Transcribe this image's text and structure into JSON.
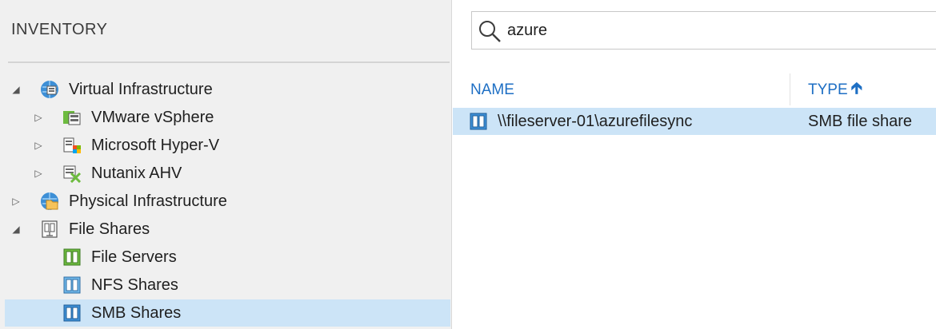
{
  "inventory": {
    "title": "INVENTORY",
    "tree": [
      {
        "label": "Virtual Infrastructure",
        "icon": "virtual-infrastructure-icon",
        "expanded": true
      },
      {
        "label": "VMware vSphere",
        "icon": "vmware-vsphere-icon",
        "expanded": false
      },
      {
        "label": "Microsoft Hyper-V",
        "icon": "hyper-v-icon",
        "expanded": false
      },
      {
        "label": "Nutanix AHV",
        "icon": "nutanix-ahv-icon",
        "expanded": false
      },
      {
        "label": "Physical Infrastructure",
        "icon": "physical-infrastructure-icon",
        "expanded": false
      },
      {
        "label": "File Shares",
        "icon": "file-shares-icon",
        "expanded": true
      },
      {
        "label": "File Servers",
        "icon": "file-servers-icon"
      },
      {
        "label": "NFS Shares",
        "icon": "nfs-shares-icon"
      },
      {
        "label": "SMB Shares",
        "icon": "smb-shares-icon",
        "selected": true
      }
    ]
  },
  "search": {
    "value": "azure",
    "icon": "search-icon"
  },
  "table": {
    "columns": [
      "NAME",
      "TYPE"
    ],
    "sorted_column": "TYPE",
    "sort_direction": "ascending",
    "rows": [
      {
        "name": "\\\\fileserver-01\\azurefilesync",
        "type": "SMB file share",
        "selected": true
      }
    ]
  },
  "colors": {
    "accent": "#1e6fc4",
    "selection": "#cce4f7",
    "pane_bg": "#f0f0f0"
  }
}
